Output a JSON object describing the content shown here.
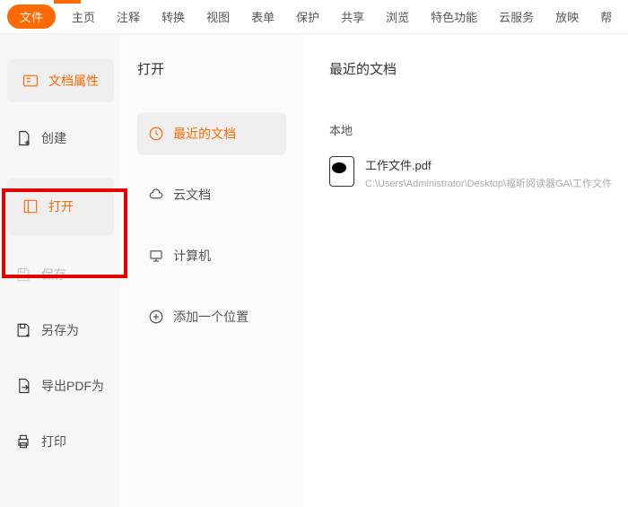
{
  "menubar": {
    "active": "文件",
    "items": [
      "主页",
      "注释",
      "转换",
      "视图",
      "表单",
      "保护",
      "共享",
      "浏览",
      "特色功能",
      "云服务",
      "放映",
      "帮"
    ]
  },
  "sidebar": {
    "items": [
      {
        "label": "文档属性",
        "icon": "properties"
      },
      {
        "label": "创建",
        "icon": "create"
      },
      {
        "label": "打开",
        "icon": "open",
        "selected": true
      },
      {
        "label": "保存",
        "icon": "save",
        "disabled": true
      },
      {
        "label": "另存为",
        "icon": "saveas"
      },
      {
        "label": "导出PDF为",
        "icon": "export"
      },
      {
        "label": "打印",
        "icon": "print"
      }
    ]
  },
  "openPanel": {
    "title": "打开",
    "options": [
      {
        "label": "最近的文档",
        "icon": "clock",
        "selected": true
      },
      {
        "label": "云文档",
        "icon": "cloud"
      },
      {
        "label": "计算机",
        "icon": "computer"
      },
      {
        "label": "添加一个位置",
        "icon": "plus"
      }
    ]
  },
  "recent": {
    "heading": "最近的文档",
    "sectionLabel": "本地",
    "files": [
      {
        "name": "工作文件.pdf",
        "path": "C:\\Users\\Administrator\\Desktop\\福昕阅读器GA\\工作文件"
      }
    ]
  }
}
